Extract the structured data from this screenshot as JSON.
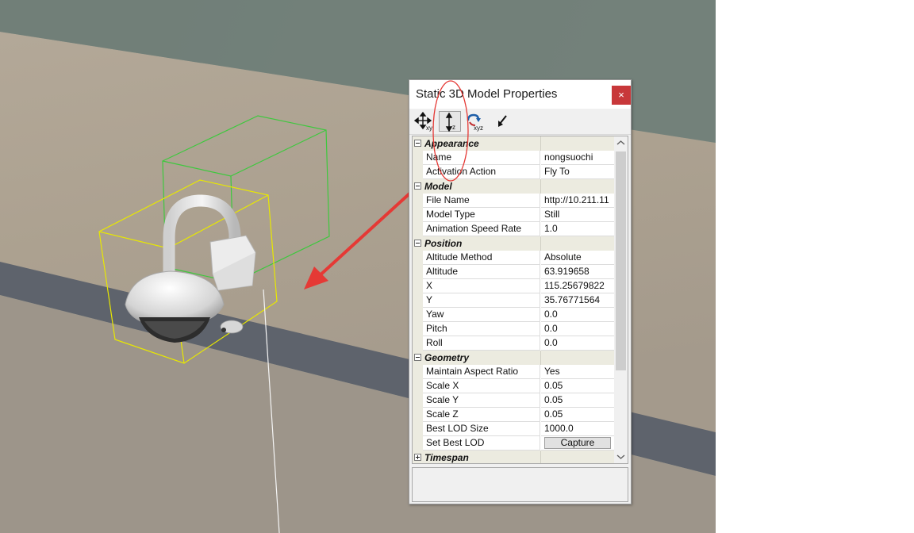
{
  "window": {
    "title": "Static 3D Model Properties",
    "close_label": "×"
  },
  "toolbar": {
    "tools": [
      {
        "icon": "move-xy-icon",
        "subscript": "xy"
      },
      {
        "icon": "move-z-icon",
        "subscript": "z"
      },
      {
        "icon": "rotate-xyz-icon",
        "subscript": "xyz"
      },
      {
        "icon": "drop-to-ground-icon",
        "subscript": ""
      }
    ]
  },
  "properties": {
    "appearance": {
      "label": "Appearance",
      "name_label": "Name",
      "name_value": "nongsuochi",
      "activation_label": "Activation Action",
      "activation_value": "Fly To"
    },
    "model": {
      "label": "Model",
      "file_label": "File Name",
      "file_value": "http://10.211.11",
      "type_label": "Model Type",
      "type_value": "Still",
      "speed_label": "Animation Speed Rate",
      "speed_value": "1.0"
    },
    "position": {
      "label": "Position",
      "altmethod_label": "Altitude Method",
      "altmethod_value": "Absolute",
      "altitude_label": "Altitude",
      "altitude_value": "63.919658",
      "x_label": "X",
      "x_value": "115.25679822",
      "y_label": "Y",
      "y_value": "35.76771564",
      "yaw_label": "Yaw",
      "yaw_value": "0.0",
      "pitch_label": "Pitch",
      "pitch_value": "0.0",
      "roll_label": "Roll",
      "roll_value": "0.0"
    },
    "geometry": {
      "label": "Geometry",
      "aspect_label": "Maintain Aspect Ratio",
      "aspect_value": "Yes",
      "scalex_label": "Scale X",
      "scalex_value": "0.05",
      "scaley_label": "Scale Y",
      "scaley_value": "0.05",
      "scalez_label": "Scale Z",
      "scalez_value": "0.05",
      "lod_label": "Best LOD Size",
      "lod_value": "1000.0",
      "setlod_label": "Set Best LOD",
      "capture_label": "Capture"
    },
    "timespan": {
      "label": "Timespan"
    }
  },
  "colors": {
    "close_button": "#c8383a",
    "annotation": "#e53935",
    "bbox_yellow": "#e8e800",
    "bbox_green": "#3ec83e",
    "category_bg": "#ecebe0"
  }
}
